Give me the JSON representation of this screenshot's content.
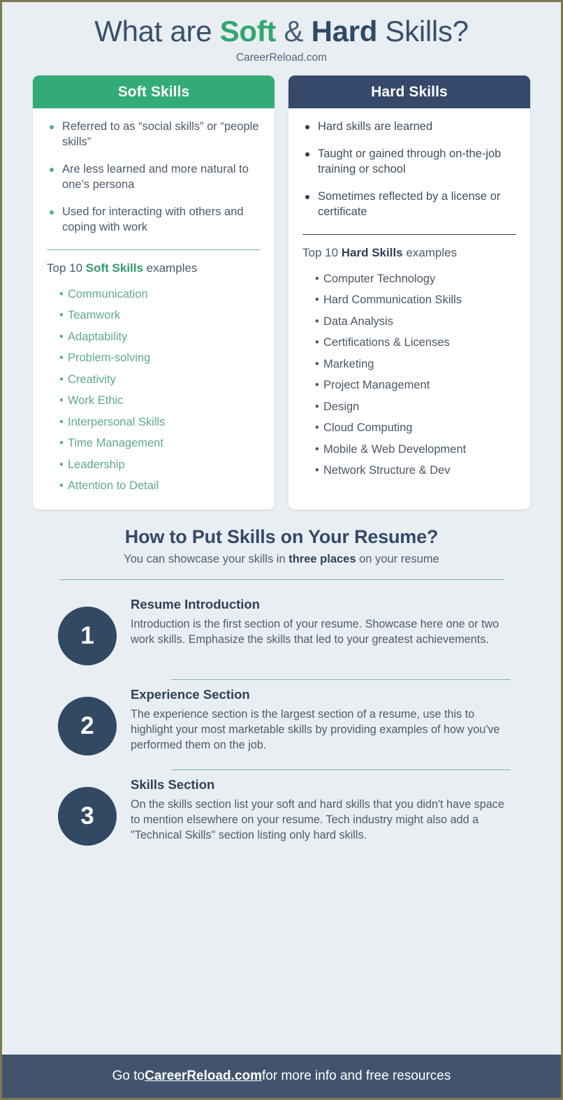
{
  "header": {
    "title_pre": "What are ",
    "title_soft": "Soft",
    "title_amp": " & ",
    "title_hard": "Hard",
    "title_post": " Skills?",
    "subtitle": "CareerReload.com"
  },
  "colors": {
    "background": "#e9eef2",
    "soft_green": "#33ab76",
    "hard_navy": "#36496a",
    "badge_navy": "#314962",
    "footer_navy": "#42546d",
    "body_text": "#4b5a6b",
    "rule_green": "#74b79f",
    "page_border": "#7d7a53"
  },
  "soft_card": {
    "heading": "Soft Skills",
    "traits": [
      "Referred to as “social skills” or “people skills”",
      "Are less learned and more natural to one’s persona",
      "Used for interacting with others and coping with work"
    ],
    "top10_pre": "Top 10 ",
    "top10_bold": "Soft Skills",
    "top10_post": " examples",
    "examples": [
      "Communication",
      "Teamwork",
      "Adaptability",
      "Problem-solving",
      "Creativity",
      "Work Ethic",
      "Interpersonal Skills",
      "Time Management",
      "Leadership",
      "Attention to Detail"
    ]
  },
  "hard_card": {
    "heading": "Hard Skills",
    "traits": [
      "Hard skills are learned",
      "Taught or gained through on-the-job training or school",
      "Sometimes reflected by a license or certificate"
    ],
    "top10_pre": "Top 10 ",
    "top10_bold": "Hard Skills",
    "top10_post": " examples",
    "examples": [
      "Computer Technology",
      "Hard Communication Skills",
      "Data Analysis",
      "Certifications & Licenses",
      "Marketing",
      "Project Management",
      "Design",
      "Cloud Computing",
      "Mobile & Web Development",
      "Network Structure & Dev"
    ]
  },
  "howto": {
    "title": "How to Put Skills on Your Resume?",
    "subtitle_pre": "You can showcase your skills in ",
    "subtitle_bold": "three places",
    "subtitle_post": " on your resume",
    "steps": [
      {
        "number": "1",
        "title": "Resume Introduction",
        "desc": "Introduction is the first section of your resume. Showcase here one or two work skills. Emphasize the skills that led to your greatest achievements."
      },
      {
        "number": "2",
        "title": "Experience Section",
        "desc": "The experience section is the largest section of a resume, use this to highlight your most marketable skills by providing examples of how you've performed them on the job."
      },
      {
        "number": "3",
        "title": "Skills Section",
        "desc": "On the skills section list your soft and hard skills that you didn't have space to mention elsewhere on your resume. Tech industry might also add a \"Technical Skills\" section listing only hard skills."
      }
    ]
  },
  "footer": {
    "pre": "Go to ",
    "link": "CareerReload.com",
    "post": " for more info and free resources"
  }
}
